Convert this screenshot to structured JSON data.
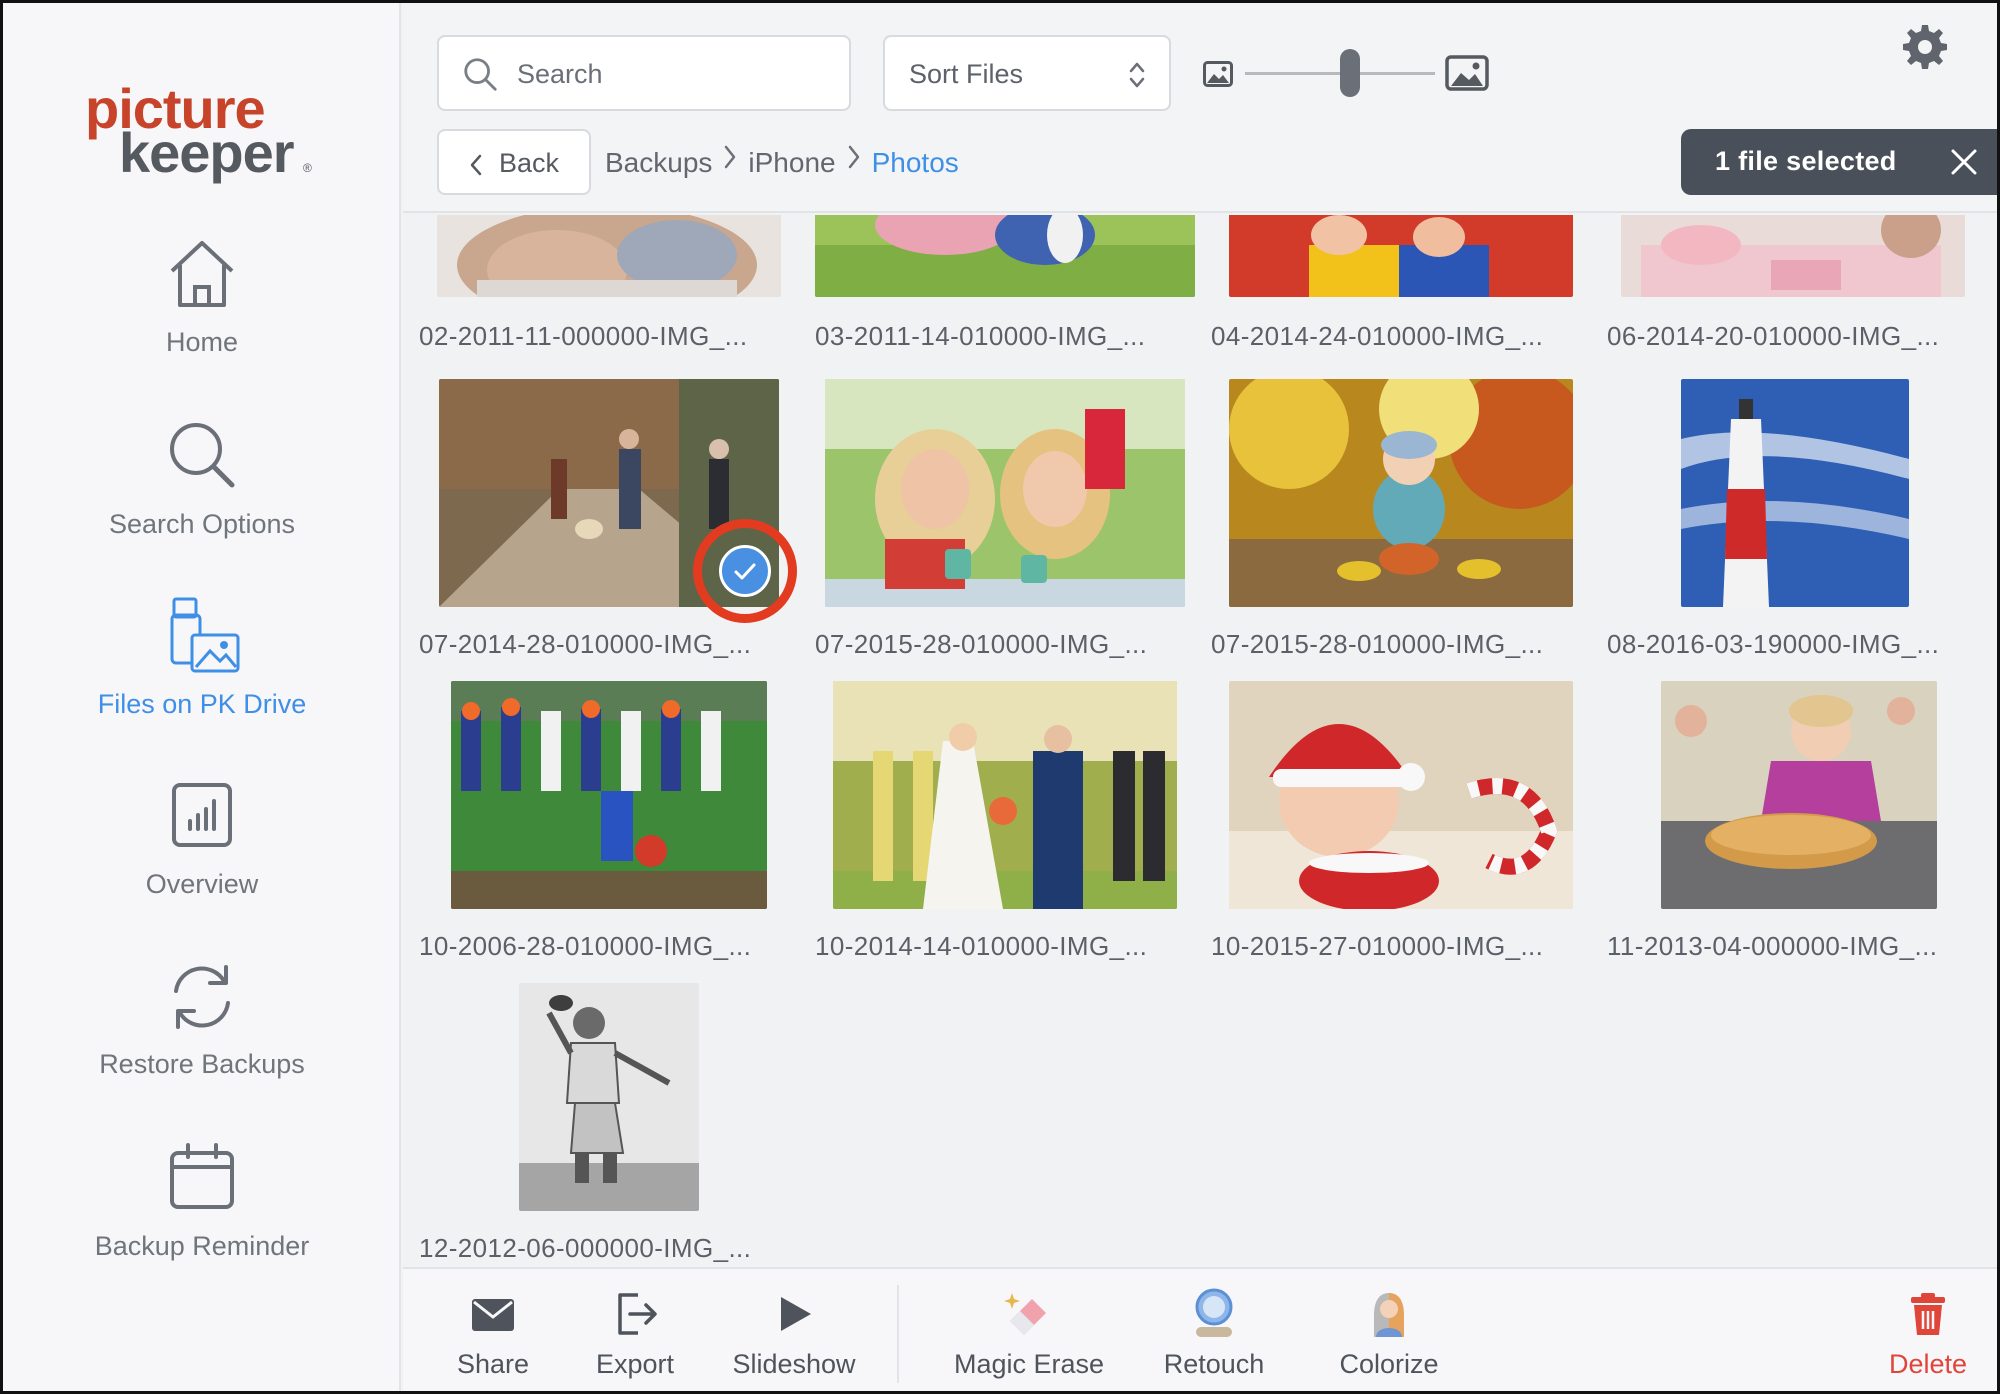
{
  "app": {
    "logo_line1": "picture",
    "logo_line2": "keeper"
  },
  "sidebar": {
    "items": [
      {
        "label": "Home",
        "icon": "home-icon",
        "active": false
      },
      {
        "label": "Search Options",
        "icon": "search-icon",
        "active": false
      },
      {
        "label": "Files on PK Drive",
        "icon": "drive-files-icon",
        "active": true
      },
      {
        "label": "Overview",
        "icon": "bar-chart-icon",
        "active": false
      },
      {
        "label": "Restore Backups",
        "icon": "refresh-icon",
        "active": false
      },
      {
        "label": "Backup Reminder",
        "icon": "calendar-icon",
        "active": false
      }
    ]
  },
  "toolbar": {
    "search_placeholder": "Search",
    "sort_label": "Sort Files",
    "thumbnail_size_level": 0.55,
    "back_label": "Back",
    "breadcrumb": [
      "Backups",
      "iPhone",
      "Photos"
    ],
    "selection_label": "1 file selected"
  },
  "files": [
    {
      "name": "02-2011-11-000000-IMG_...",
      "selected": false
    },
    {
      "name": "03-2011-14-010000-IMG_...",
      "selected": false
    },
    {
      "name": "04-2014-24-010000-IMG_...",
      "selected": false
    },
    {
      "name": "06-2014-20-010000-IMG_...",
      "selected": false
    },
    {
      "name": "07-2014-28-010000-IMG_...",
      "selected": true
    },
    {
      "name": "07-2015-28-010000-IMG_...",
      "selected": false
    },
    {
      "name": "07-2015-28-010000-IMG_...",
      "selected": false
    },
    {
      "name": "08-2016-03-190000-IMG_...",
      "selected": false
    },
    {
      "name": "10-2006-28-010000-IMG_...",
      "selected": false
    },
    {
      "name": "10-2014-14-010000-IMG_...",
      "selected": false
    },
    {
      "name": "10-2015-27-010000-IMG_...",
      "selected": false
    },
    {
      "name": "11-2013-04-000000-IMG_...",
      "selected": false
    },
    {
      "name": "12-2012-06-000000-IMG_...",
      "selected": false
    }
  ],
  "actions": {
    "share": "Share",
    "export": "Export",
    "slideshow": "Slideshow",
    "magic_erase": "Magic Erase",
    "retouch": "Retouch",
    "colorize": "Colorize",
    "delete": "Delete"
  },
  "colors": {
    "accent": "#3f8fe6",
    "brand_red": "#c7442b",
    "danger": "#e0453a",
    "selection_pill": "#4a5059",
    "highlight_ring": "#e23b1f"
  }
}
